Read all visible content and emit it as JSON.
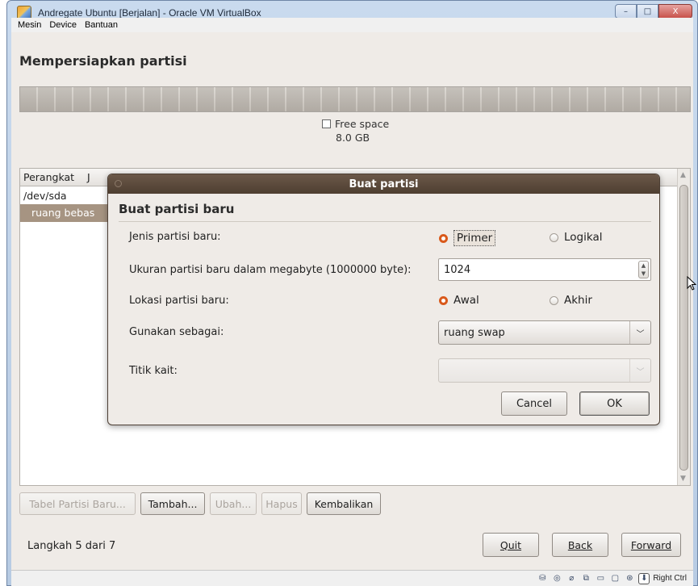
{
  "window": {
    "title": "Andregate Ubuntu [Berjalan] - Oracle VM VirtualBox",
    "minimize_glyph": "–",
    "maximize_glyph": "□",
    "close_glyph": "X"
  },
  "menubar": {
    "items": [
      "Mesin",
      "Device",
      "Bantuan"
    ]
  },
  "installer": {
    "page_title": "Mempersiapkan partisi",
    "legend_label": "Free space",
    "legend_size": "8.0 GB",
    "tree": {
      "header_col1": "Perangkat",
      "header_col2": "J",
      "rows": [
        "/dev/sda",
        "ruang bebas"
      ]
    },
    "buttons": {
      "new_table": "Tabel Partisi Baru...",
      "add": "Tambah...",
      "change": "Ubah...",
      "delete": "Hapus",
      "revert": "Kembalikan"
    },
    "step": "Langkah 5 dari 7",
    "nav": {
      "quit": "Quit",
      "back": "Back",
      "forward": "Forward"
    }
  },
  "dialog": {
    "title": "Buat partisi",
    "heading": "Buat partisi baru",
    "type_label": "Jenis partisi baru:",
    "type_primary": "Primer",
    "type_logical": "Logikal",
    "size_label": "Ukuran partisi baru dalam megabyte (1000000 byte):",
    "size_value": "1024",
    "location_label": "Lokasi partisi baru:",
    "location_begin": "Awal",
    "location_end": "Akhir",
    "use_as_label": "Gunakan sebagai:",
    "use_as_value": "ruang swap",
    "mount_label": "Titik kait:",
    "mount_value": "",
    "cancel": "Cancel",
    "ok": "OK"
  },
  "statusbar": {
    "host_key": "Right Ctrl",
    "icons": [
      "hard-disk-icon",
      "cd-icon",
      "usb-icon",
      "network-icon",
      "shared-folder-icon",
      "display-icon",
      "vrdp-icon",
      "mouse-integration-icon"
    ]
  },
  "colors": {
    "radio_accent": "#d9591b",
    "dialog_titlebar": "#5a4838",
    "selection": "#a69482",
    "window_chrome": "#c9daee"
  }
}
